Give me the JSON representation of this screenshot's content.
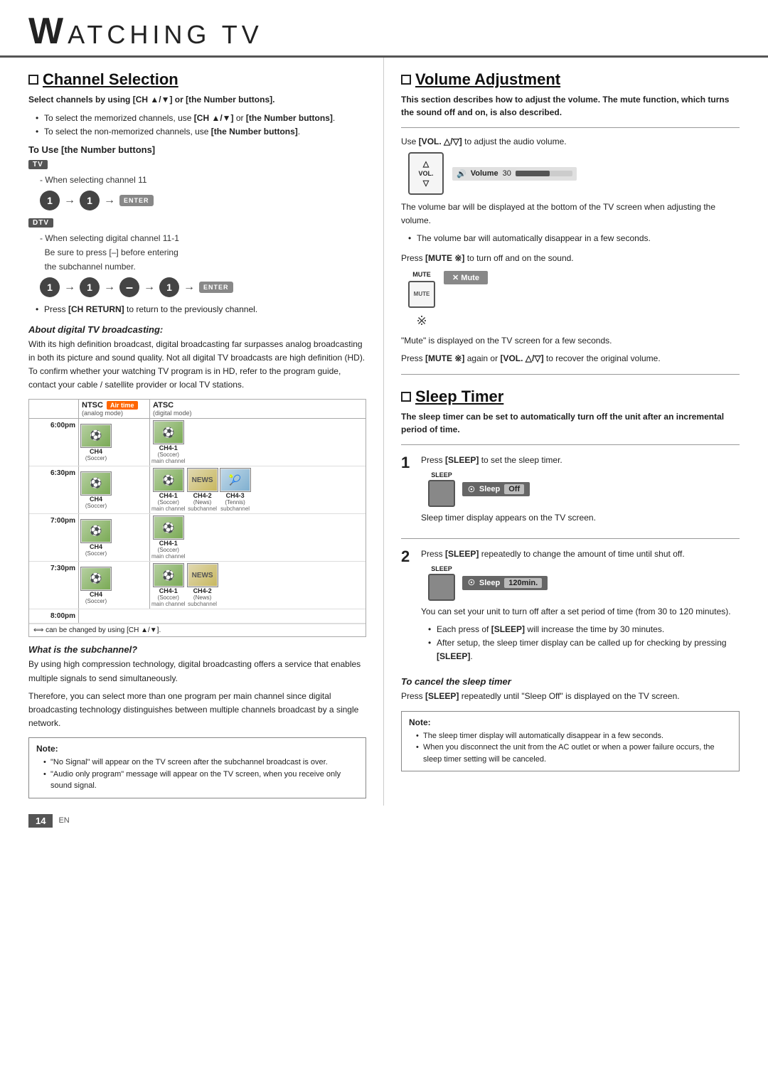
{
  "header": {
    "w_letter": "W",
    "title": "ATCHING  TV"
  },
  "left": {
    "channel_section": {
      "title": "Channel Selection",
      "intro": "Select channels by using [CH ▲/▼] or [the Number buttons].",
      "bullets": [
        "To select the memorized channels, use [CH ▲/▼] or [the Number buttons].",
        "To select the non-memorized channels, use [the Number buttons]."
      ],
      "to_use_heading": "To Use [the Number buttons]",
      "tv_badge": "TV",
      "tv_note": "When selecting channel 11",
      "dtv_badge": "DTV",
      "dtv_note1": "When selecting digital channel 11-1",
      "dtv_note2": "Be sure to press [–] before entering",
      "dtv_note3": "the subchannel number.",
      "ch_return_text": "Press [CH RETURN] to return to the previously channel.",
      "about_heading": "About digital TV broadcasting:",
      "about_text": "With its high definition broadcast, digital broadcasting far surpasses analog broadcasting in both its picture and sound quality. Not all digital TV broadcasts are high definition (HD). To confirm whether your watching TV program is in HD, refer to the program guide, contact your cable / satellite provider or local TV stations.",
      "grid": {
        "ntsc_label": "NTSC",
        "ntsc_sub": "(analog mode)",
        "atsc_label": "ATSC",
        "atsc_sub": "(digital mode)",
        "airtime_label": "Air time",
        "rows": [
          {
            "time": "6:00pm",
            "ntsc_ch": "CH4",
            "ntsc_prog": "Soccer",
            "atsc_main": "CH4-1",
            "atsc_main_prog": "Soccer",
            "atsc_extra": []
          },
          {
            "time": "6:30pm",
            "ntsc_ch": "CH4",
            "ntsc_prog": "Soccer",
            "atsc_main": "CH4-1",
            "atsc_main_prog": "Soccer",
            "atsc_extra": [
              {
                "ch": "CH4-2",
                "prog": "News",
                "type": "news"
              },
              {
                "ch": "CH4-3",
                "prog": "Tennis",
                "type": "tennis"
              }
            ]
          },
          {
            "time": "7:00pm",
            "ntsc_ch": "CH4",
            "ntsc_prog": "Soccer",
            "atsc_main": "CH4-1",
            "atsc_main_prog": "Soccer",
            "atsc_extra": []
          },
          {
            "time": "7:30pm",
            "ntsc_ch": "CH4",
            "ntsc_prog": "Soccer",
            "atsc_main": "CH4-1",
            "atsc_main_prog": "Soccer",
            "atsc_extra": [
              {
                "ch": "CH4-2",
                "prog": "News",
                "type": "news"
              }
            ]
          }
        ],
        "end_time": "8:00pm",
        "footer_text": "⟺ can be changed by using [CH ▲/▼]."
      },
      "what_heading": "What is the subchannel?",
      "what_text1": "By using high compression technology, digital broadcasting offers a service that enables multiple signals to send simultaneously.",
      "what_text2": "Therefore, you can select more than one program per main channel since digital broadcasting technology distinguishes between multiple channels broadcast by a single network.",
      "note_title": "Note:",
      "note_bullets": [
        "\"No Signal\" will appear on the TV screen after the subchannel broadcast is over.",
        "\"Audio only program\" message will appear on the TV screen, when you receive only sound signal."
      ]
    }
  },
  "right": {
    "volume_section": {
      "title": "Volume Adjustment",
      "intro": "This section describes how to adjust the volume. The mute function, which turns the sound off and on, is also described.",
      "use_vol_text": "Use [VOL. △/▽] to adjust the audio volume.",
      "vol_number": "30",
      "vol_label": "Volume",
      "vol_percent": 60,
      "vol_bar_text": "The volume bar will be displayed at the bottom of the TV screen when adjusting the volume.",
      "bullet1": "The volume bar will automatically disappear in a few seconds.",
      "press_mute_text": "Press [MUTE ※] to turn off and on the sound.",
      "mute_label": "MUTE",
      "mute_screen_label": "Mute",
      "mute_symbol": "※",
      "mute_text1": "\"Mute\" is displayed on the TV screen for a few seconds.",
      "mute_recover_text": "Press [MUTE ※] again or [VOL. △/▽] to recover the original volume."
    },
    "sleep_section": {
      "title": "Sleep Timer",
      "intro": "The sleep timer can be set to automatically turn off the unit after an incremental period of time.",
      "step1_text": "Press [SLEEP] to set the sleep timer.",
      "sleep_label": "SLEEP",
      "sleep_val1": "Off",
      "step1_note": "Sleep timer display appears on the TV screen.",
      "step2_text": "Press [SLEEP] repeatedly to change the amount of time until shut off.",
      "sleep_val2": "120min.",
      "step2_body": "You can set your unit to turn off after a set period of time (from 30 to 120 minutes).",
      "bullet1": "Each press of [SLEEP] will increase the time by 30 minutes.",
      "bullet2": "After setup, the sleep timer display can be called up for checking by pressing [SLEEP].",
      "to_cancel_heading": "To cancel the sleep timer",
      "to_cancel_text": "Press [SLEEP] repeatedly until \"Sleep Off\" is displayed on the TV screen.",
      "note_title": "Note:",
      "note_bullets": [
        "The sleep timer display will automatically disappear in a few seconds.",
        "When you disconnect the unit from the AC outlet or when a power failure occurs, the sleep timer setting will be canceled."
      ]
    }
  },
  "footer": {
    "page_number": "14",
    "lang": "EN"
  }
}
